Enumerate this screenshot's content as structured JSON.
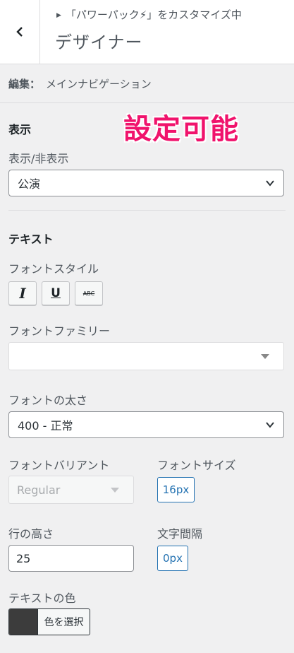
{
  "header": {
    "subtitle": "「パワーパック⚡」をカスタマイズ中",
    "title": "デザイナー"
  },
  "edit": {
    "label": "編集：",
    "value": "メインナビゲーション"
  },
  "overlay_text": "設定可能",
  "display": {
    "section_title": "表示",
    "visibility_label": "表示/非表示",
    "visibility_value": "公演"
  },
  "text": {
    "section_title": "テキスト",
    "font_style_label": "フォントスタイル",
    "style_buttons": [
      "I",
      "U",
      "ABC"
    ],
    "font_family_label": "フォントファミリー",
    "font_family_value": "",
    "font_weight_label": "フォントの太さ",
    "font_weight_value": "400 - 正常",
    "font_variant_label": "フォントバリアント",
    "font_variant_value": "Regular",
    "font_size_label": "フォントサイズ",
    "font_size_value": "16px",
    "line_height_label": "行の高さ",
    "line_height_value": "25",
    "letter_spacing_label": "文字間隔",
    "letter_spacing_value": "0px",
    "text_color_label": "テキストの色",
    "text_color_button": "色を選択",
    "text_color_swatch": "#3c3c3c"
  },
  "colors": {
    "accent": "#2271b1",
    "overlay": "#f0136c"
  }
}
